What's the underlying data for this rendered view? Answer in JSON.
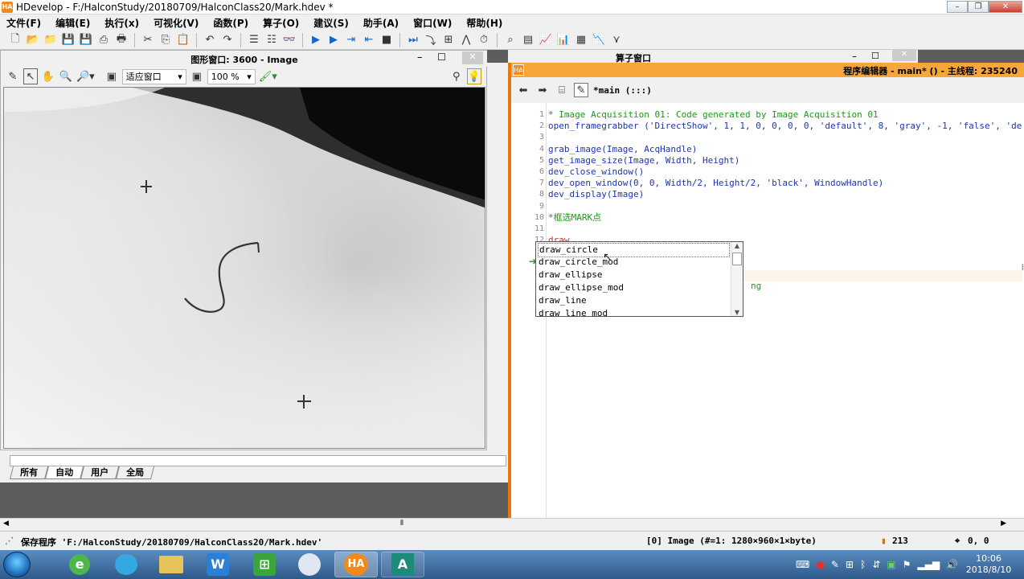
{
  "window": {
    "title": "HDevelop - F:/HalconStudy/20180709/HalconClass20/Mark.hdev *",
    "app_icon": "HA"
  },
  "menu": [
    "文件(F)",
    "编辑(E)",
    "执行(x)",
    "可视化(V)",
    "函数(P)",
    "算子(O)",
    "建议(S)",
    "助手(A)",
    "窗口(W)",
    "帮助(H)"
  ],
  "graphics": {
    "title": "图形窗口: 3600 - Image",
    "fit_label": "适应窗口",
    "zoom_label": "100 %"
  },
  "variable_tabs": [
    "所有",
    "自动",
    "用户",
    "全局"
  ],
  "operator_window": {
    "title": "算子窗口"
  },
  "editor": {
    "title": "程序编辑器 - main* () - 主线程: 235240",
    "icon": "HA",
    "procedure": "*main (:::)",
    "lines": [
      {
        "n": "1",
        "text": "* Image Acquisition 01: Code generated by Image Acquisition 01",
        "kind": "comment"
      },
      {
        "n": "2",
        "text": "open_framegrabber ('DirectShow', 1, 1, 0, 0, 0, 0, 'default', 8, 'gray', -1, 'false', 'de",
        "kind": "normal"
      },
      {
        "n": "3",
        "text": "",
        "kind": "normal"
      },
      {
        "n": "4",
        "text": "grab_image(Image, AcqHandle)",
        "kind": "normal"
      },
      {
        "n": "5",
        "text": "get_image_size(Image, Width, Height)",
        "kind": "normal"
      },
      {
        "n": "6",
        "text": "dev_close_window()",
        "kind": "normal"
      },
      {
        "n": "7",
        "text": "dev_open_window(0, 0, Width/2, Height/2, 'black', WindowHandle)",
        "kind": "normal"
      },
      {
        "n": "8",
        "text": "dev_display(Image)",
        "kind": "normal"
      },
      {
        "n": "9",
        "text": "",
        "kind": "normal"
      },
      {
        "n": "10",
        "text": "*框选MARK点",
        "kind": "comment"
      },
      {
        "n": "11",
        "text": "",
        "kind": "normal"
      },
      {
        "n": "12",
        "text": "draw",
        "kind": "curline"
      },
      {
        "n": "",
        "text": "",
        "kind": "normal"
      },
      {
        "n": "",
        "text": "",
        "kind": "normal"
      },
      {
        "n": "",
        "text": "",
        "kind": "normal"
      },
      {
        "n": "",
        "text": "ng",
        "kind": "comment"
      }
    ]
  },
  "autocomplete": [
    "draw_circle",
    "draw_circle_mod",
    "draw_ellipse",
    "draw_ellipse_mod",
    "draw_line",
    "draw_line_mod"
  ],
  "status": {
    "message": "保存程序 'F:/HalconStudy/20180709/HalconClass20/Mark.hdev'",
    "image_info": "[0] Image (#=1: 1280×960×1×byte)",
    "gray_value": "213",
    "coords": "0, 0"
  },
  "taskbar": {
    "time": "10:06",
    "date": "2018/8/10",
    "apps": [
      "HA",
      "A"
    ]
  }
}
